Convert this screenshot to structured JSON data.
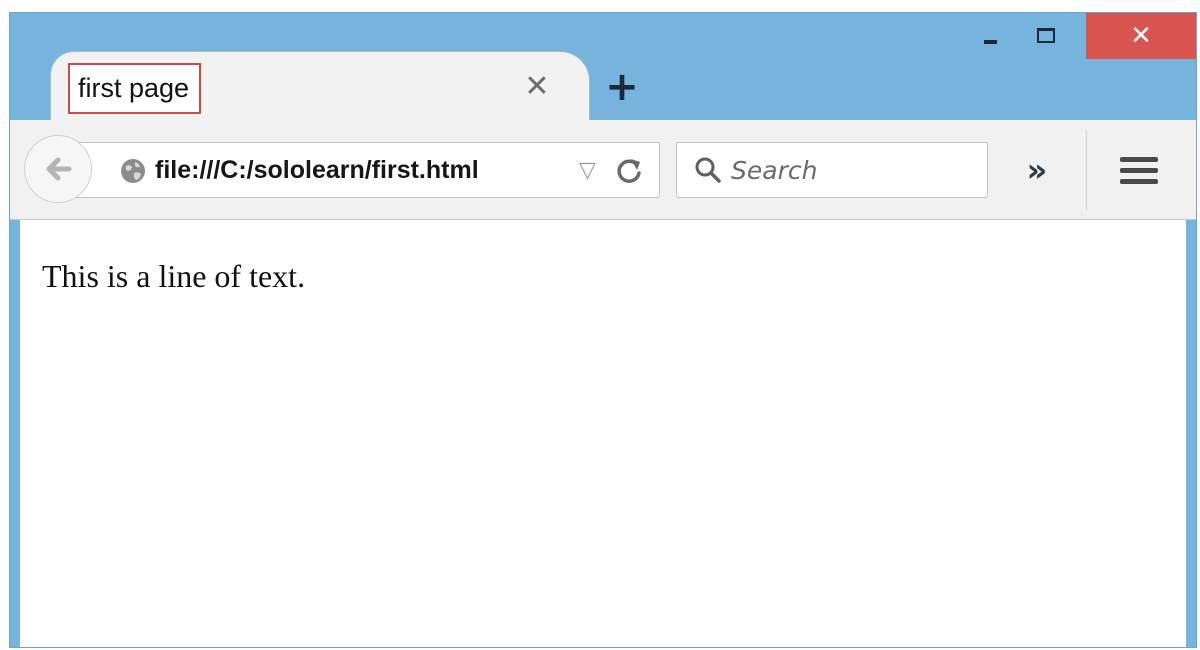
{
  "window": {
    "minimize_icon": "minimize-icon",
    "maximize_icon": "maximize-icon",
    "close_glyph": "✕",
    "close_color": "#d9534f",
    "frame_color": "#76b4de"
  },
  "tab": {
    "title": "first page",
    "close_glyph": "✕",
    "highlight_color": "#d04848"
  },
  "new_tab": {
    "glyph": "+"
  },
  "navigation": {
    "back_icon": "back-arrow-icon",
    "site_icon": "globe-icon",
    "url": "file:///C:/sololearn/first.html",
    "dropdown_glyph": "▽",
    "reload_icon": "reload-icon"
  },
  "search": {
    "placeholder": "Search",
    "value": ""
  },
  "toolbar": {
    "overflow_glyph": "»",
    "menu_icon": "hamburger-menu-icon"
  },
  "content": {
    "text": "This is a line of text."
  }
}
